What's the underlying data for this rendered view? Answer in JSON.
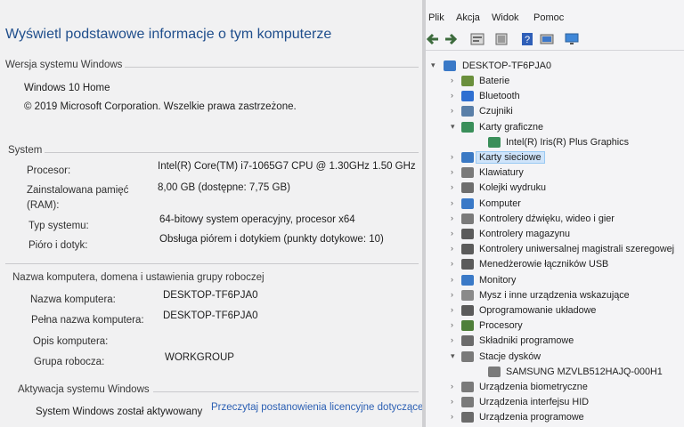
{
  "system_window": {
    "title": "Wyświetl podstawowe informacje o tym komputerze",
    "windows_section": {
      "heading": "Wersja systemu Windows",
      "edition": "Windows 10 Home",
      "copyright": "© 2019 Microsoft Corporation. Wszelkie prawa zastrzeżone."
    },
    "system_section": {
      "heading": "System",
      "rows": [
        {
          "label": "Procesor:",
          "value": "Intel(R) Core(TM) i7-1065G7 CPU @ 1.30GHz   1.50 GHz"
        },
        {
          "label": "Zainstalowana pamięć",
          "label2": "(RAM):",
          "value": "8,00 GB (dostępne: 7,75 GB)"
        },
        {
          "label": "Typ systemu:",
          "value": "64-bitowy system operacyjny, procesor x64"
        },
        {
          "label": "Pióro i dotyk:",
          "value": "Obsługa piórem i dotykiem (punkty dotykowe: 10)"
        }
      ]
    },
    "computer_section": {
      "heading": "Nazwa komputera, domena i ustawienia grupy roboczej",
      "rows": [
        {
          "label": "Nazwa komputera:",
          "value": "DESKTOP-TF6PJA0"
        },
        {
          "label": "Pełna nazwa komputera:",
          "value": "DESKTOP-TF6PJA0"
        },
        {
          "label": "Opis komputera:",
          "value": ""
        },
        {
          "label": "Grupa robocza:",
          "value": "WORKGROUP"
        }
      ]
    },
    "activation_section": {
      "heading": "Aktywacja systemu Windows",
      "status": "System Windows został aktywowany",
      "link": "Przeczytaj postanowienia licencyjne dotyczące o"
    }
  },
  "device_manager": {
    "menu": [
      "Plik",
      "Akcja",
      "Widok",
      "Pomoc"
    ],
    "toolbar": [
      "back-arrow-icon",
      "forward-arrow-icon",
      "properties-icon",
      "device-list-icon",
      "help-icon",
      "update-driver-icon",
      "monitor-icon"
    ],
    "root": "DESKTOP-TF6PJA0",
    "nodes": [
      {
        "label": "Baterie",
        "icon": "battery-icon",
        "color": "#6a8f3c"
      },
      {
        "label": "Bluetooth",
        "icon": "bluetooth-icon",
        "color": "#2f6fd1"
      },
      {
        "label": "Czujniki",
        "icon": "sensor-icon",
        "color": "#5a7fa8"
      },
      {
        "label": "Karty graficzne",
        "icon": "display-adapter-icon",
        "color": "#3a8f5a",
        "expanded": true
      },
      {
        "label": "Intel(R) Iris(R) Plus Graphics",
        "icon": "display-adapter-icon",
        "color": "#3a8f5a",
        "child": true
      },
      {
        "label": "Karty sieciowe",
        "icon": "network-adapter-icon",
        "color": "#3b79c4",
        "selected": true
      },
      {
        "label": "Klawiatury",
        "icon": "keyboard-icon",
        "color": "#7a7a7a"
      },
      {
        "label": "Kolejki wydruku",
        "icon": "printer-icon",
        "color": "#6e6e6e"
      },
      {
        "label": "Komputer",
        "icon": "computer-icon",
        "color": "#3a79c7"
      },
      {
        "label": "Kontrolery dźwięku, wideo i gier",
        "icon": "speaker-icon",
        "color": "#7a7a7a"
      },
      {
        "label": "Kontrolery magazynu",
        "icon": "storage-controller-icon",
        "color": "#5b5b5b"
      },
      {
        "label": "Kontrolery uniwersalnej magistrali szeregowej",
        "icon": "usb-icon",
        "color": "#5b5b5b"
      },
      {
        "label": "Menedżerowie łączników USB",
        "icon": "usb-connector-icon",
        "color": "#5b5b5b"
      },
      {
        "label": "Monitory",
        "icon": "monitor-icon",
        "color": "#3a79c7"
      },
      {
        "label": "Mysz i inne urządzenia wskazujące",
        "icon": "mouse-icon",
        "color": "#8a8a8a"
      },
      {
        "label": "Oprogramowanie układowe",
        "icon": "firmware-icon",
        "color": "#5b5b5b"
      },
      {
        "label": "Procesory",
        "icon": "processor-icon",
        "color": "#4f7f3a"
      },
      {
        "label": "Składniki programowe",
        "icon": "software-component-icon",
        "color": "#6b6b6b"
      },
      {
        "label": "Stacje dysków",
        "icon": "disk-drive-icon",
        "color": "#7a7a7a",
        "expanded": true
      },
      {
        "label": "SAMSUNG MZVLB512HAJQ-000H1",
        "icon": "disk-drive-icon",
        "color": "#7a7a7a",
        "child": true
      },
      {
        "label": "Urządzenia biometryczne",
        "icon": "biometric-icon",
        "color": "#7a7a7a"
      },
      {
        "label": "Urządzenia interfejsu HID",
        "icon": "hid-icon",
        "color": "#7a7a7a"
      },
      {
        "label": "Urządzenia programowe",
        "icon": "software-device-icon",
        "color": "#6b6b6b"
      }
    ]
  }
}
